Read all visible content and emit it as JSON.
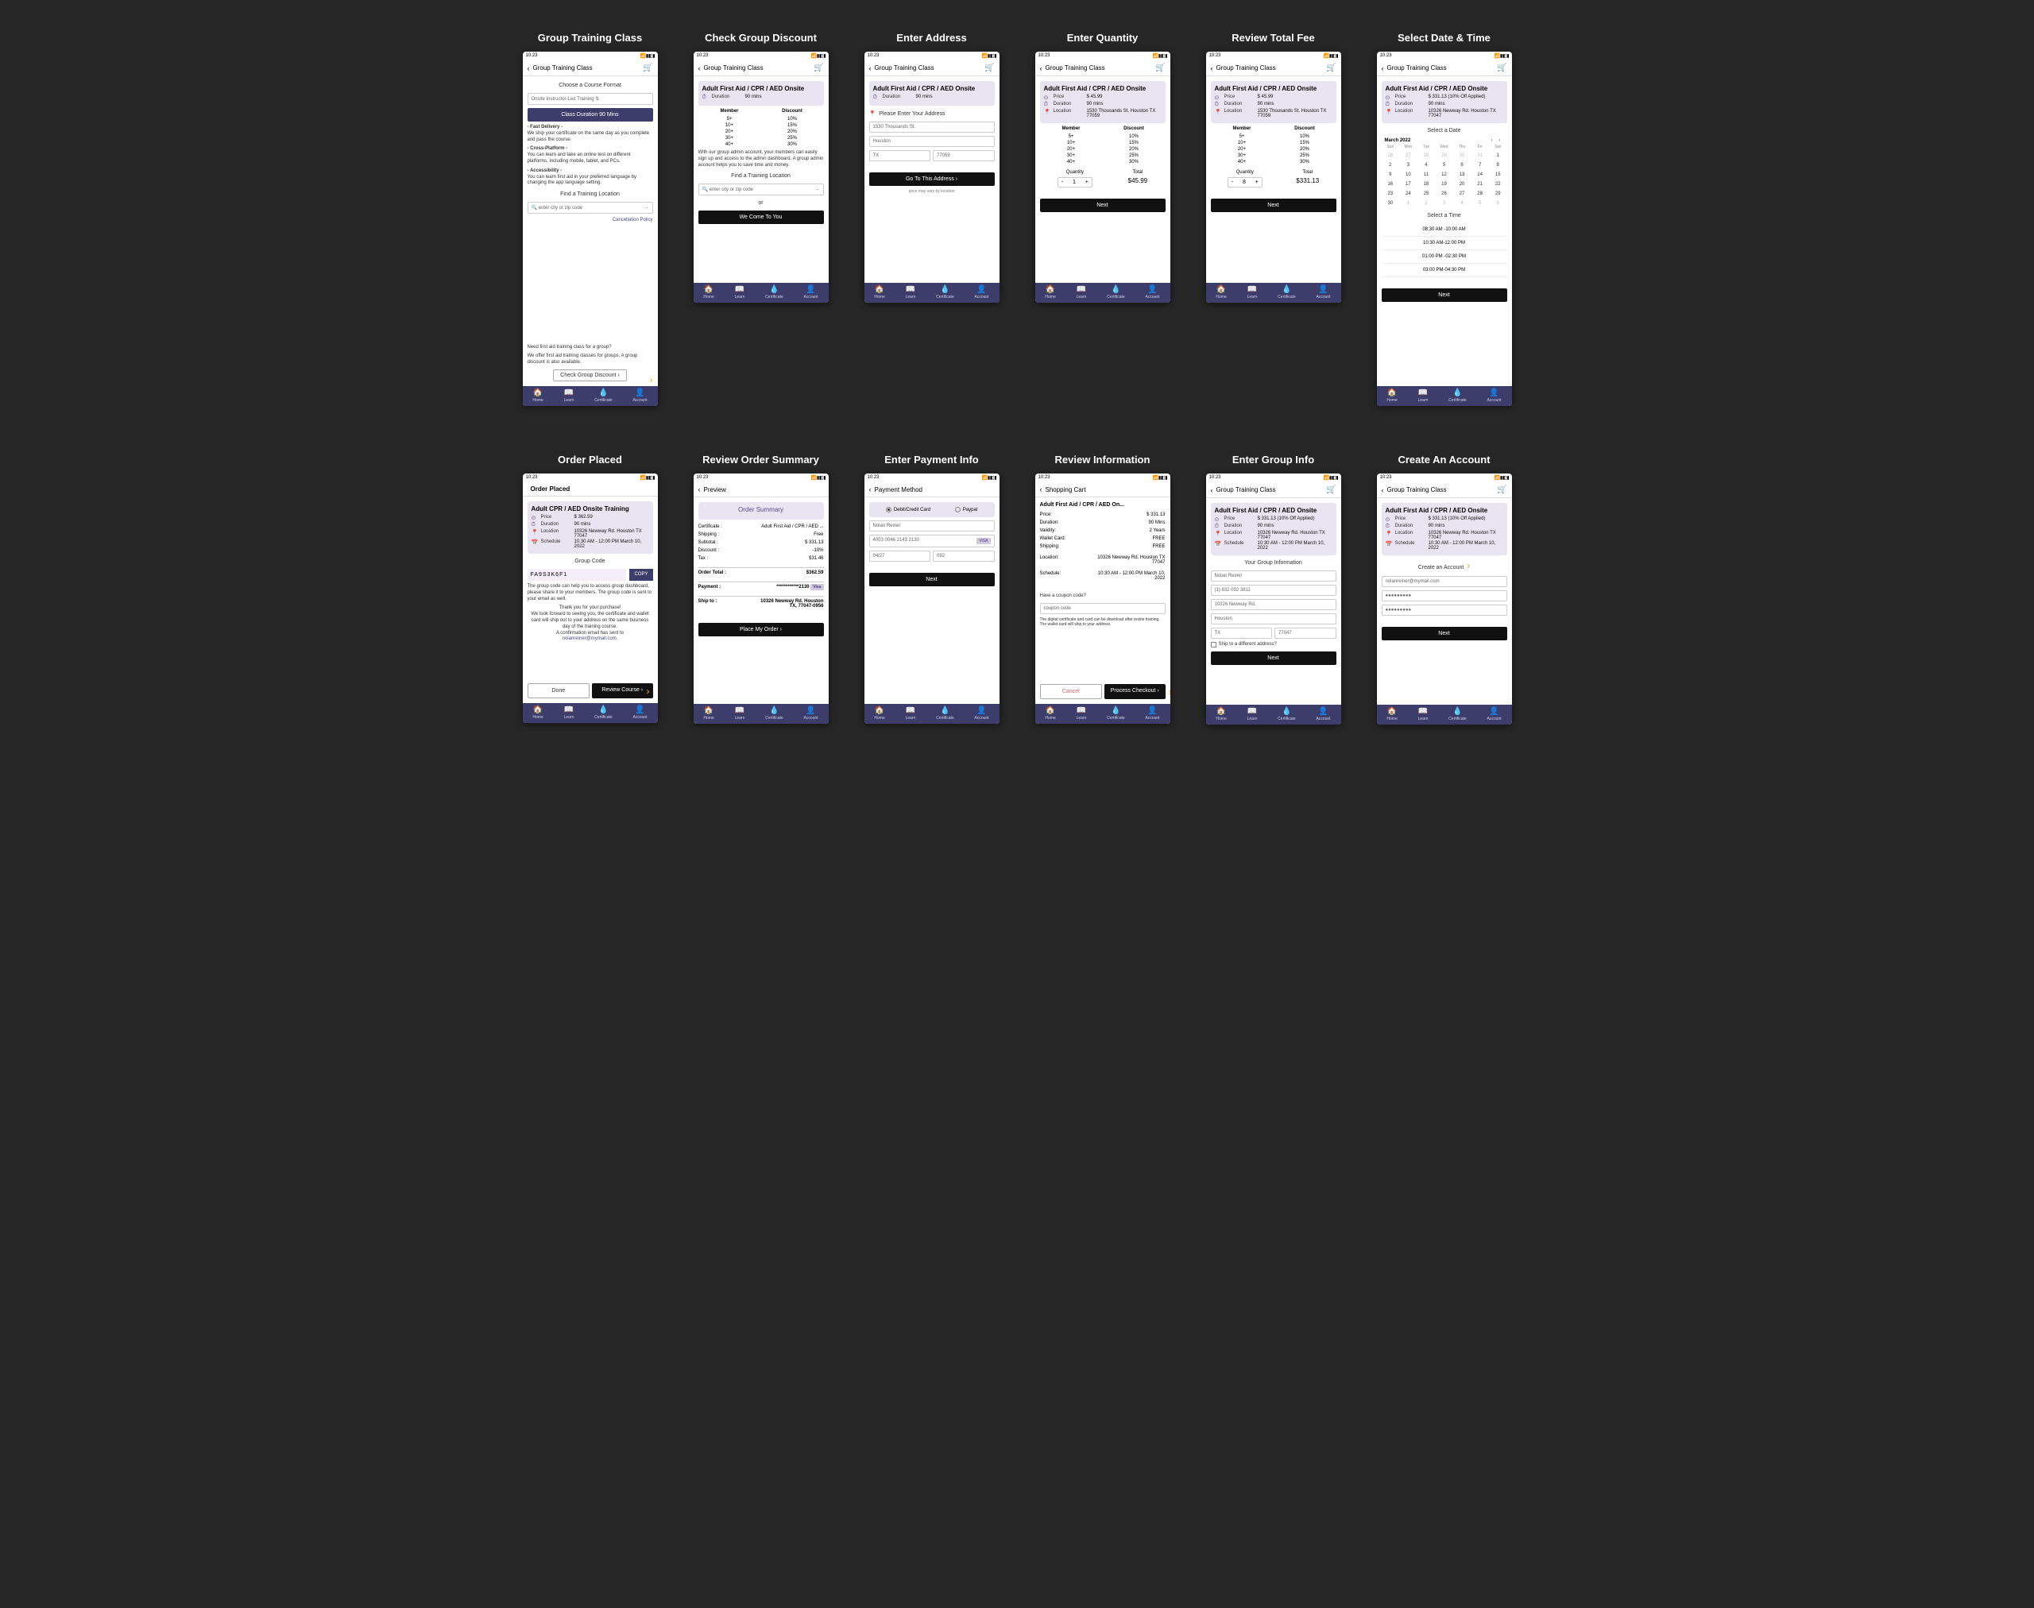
{
  "shared": {
    "time": "10:23",
    "signals": "📶 ▮ ◧ ▮",
    "cart_icon": "🛒",
    "back": "‹",
    "nav": [
      {
        "icon": "🏠",
        "label": "Home"
      },
      {
        "icon": "📖",
        "label": "Learn"
      },
      {
        "icon": "💧",
        "label": "Certificate"
      },
      {
        "icon": "👤",
        "label": "Account"
      }
    ],
    "hdr_class": "Group Training Class",
    "course_onsite": "Adult First Aid / CPR / AED Onsite",
    "next": "Next",
    "lbl_price": "Price",
    "lbl_duration": "Duration",
    "lbl_location": "Location",
    "lbl_schedule": "Schedule",
    "dur90": "90 mins",
    "addr1": "10326 Newway Rd. Houston TX 77047",
    "sched1": "10:30 AM - 12:00 PM March 10, 2022",
    "find_loc": "Find a Training Location",
    "find_ph": "🔍 enter city or zip code"
  },
  "discount_table": {
    "h1": "Member",
    "h2": "Discount",
    "rows": [
      [
        "5+",
        "10%"
      ],
      [
        "10+",
        "15%"
      ],
      [
        "20+",
        "20%"
      ],
      [
        "30+",
        "25%"
      ],
      [
        "40+",
        "30%"
      ]
    ]
  },
  "s1": {
    "cap": "Group Training Class",
    "choose": "Choose a Course Format",
    "fmt": "Onsite Instructor-Led Training ⇅",
    "dur_btn": "Class Duration  90 Mins",
    "f1t": "- Fast Delivery -",
    "f1b": "We ship your certificate on the same day as you complete and pass the course.",
    "f2t": "- Cross-Platform -",
    "f2b": "You can learn and take an online test on different platforms, including mobile, tablet, and PCs.",
    "f3t": "- Accessibility -",
    "f3b": "You can learn first aid in your preferred language by changing the app language setting.",
    "cxl": "Cancellation Policy",
    "g1": "Need first aid training class for a group?",
    "g2": "We offer first aid training classes for groups. A group discount is also available.",
    "gbtn": "Check Group Discount  ›"
  },
  "s2": {
    "cap": "Check Group Discount",
    "note": "With our group admin account, your members can easily sign up and access to the admin dashboard. A group admin account helps you to save time and money.",
    "or": "or",
    "come": "We Come To You"
  },
  "s3": {
    "cap": "Enter Address",
    "prompt": "Please Enter Your Address",
    "a1": "1530  Thousands St.",
    "a2": "Houston",
    "a3": "TX",
    "a4": "77059",
    "go": "Go To This Address  ›",
    "sub": "price may vary by location"
  },
  "s4": {
    "cap": "Enter Quantity",
    "price": "$ 45.99",
    "loc": "1530 Thousands St. Houston TX 77059",
    "qlab": "Quantity",
    "tlab": "Total",
    "q": "1",
    "t": "$45.99",
    "minus": "-",
    "plus": "+"
  },
  "s5": {
    "cap": "Review Total Fee",
    "price": "$ 45.99",
    "loc": "1530 Thousands St. Houston TX 77059",
    "q": "8",
    "t": "$331.13"
  },
  "s6": {
    "cap": "Select Date & Time",
    "price": "$ 331.13 (10% Off Applied)",
    "sel_date": "Select a Date",
    "month": "March 2022",
    "dow": [
      "Sun",
      "Mon",
      "Tue",
      "Wed",
      "Thu",
      "Fri",
      "Sat"
    ],
    "weeks": [
      [
        {
          "d": "26",
          "m": 1
        },
        {
          "d": "27",
          "m": 1
        },
        {
          "d": "28",
          "m": 1
        },
        {
          "d": "29",
          "m": 1
        },
        {
          "d": "30",
          "m": 1
        },
        {
          "d": "31",
          "m": 1
        },
        {
          "d": "1"
        }
      ],
      [
        {
          "d": "2"
        },
        {
          "d": "3"
        },
        {
          "d": "4"
        },
        {
          "d": "5"
        },
        {
          "d": "6"
        },
        {
          "d": "7"
        },
        {
          "d": "8"
        }
      ],
      [
        {
          "d": "9"
        },
        {
          "d": "10"
        },
        {
          "d": "11"
        },
        {
          "d": "12"
        },
        {
          "d": "13"
        },
        {
          "d": "14"
        },
        {
          "d": "15"
        }
      ],
      [
        {
          "d": "16"
        },
        {
          "d": "17"
        },
        {
          "d": "18"
        },
        {
          "d": "19"
        },
        {
          "d": "20"
        },
        {
          "d": "21"
        },
        {
          "d": "22"
        }
      ],
      [
        {
          "d": "23"
        },
        {
          "d": "24"
        },
        {
          "d": "25"
        },
        {
          "d": "26"
        },
        {
          "d": "27"
        },
        {
          "d": "28"
        },
        {
          "d": "29"
        }
      ],
      [
        {
          "d": "30"
        },
        {
          "d": "1",
          "m": 1
        },
        {
          "d": "2",
          "m": 1
        },
        {
          "d": "3",
          "m": 1
        },
        {
          "d": "4",
          "m": 1
        },
        {
          "d": "5",
          "m": 1
        },
        {
          "d": "6",
          "m": 1
        }
      ]
    ],
    "sel_time": "Select a Time",
    "slots": [
      "08:30 AM -10:00 AM",
      "10:30 AM-12:00 PM",
      "01:00 PM -02:30 PM",
      "03:00 PM-04:30 PM"
    ]
  },
  "s7": {
    "cap": "Create An Account",
    "price": "$ 331.13 (10% Off Applied)",
    "acct": "Create an Account",
    "email": "nolanreiner@mymail.com",
    "pw": "●●●●●●●●●"
  },
  "s8": {
    "cap": "Enter Group Info",
    "price": "$ 331.13 (10% Off Applied)",
    "git": "Your Group Information",
    "name": "Nolan Reiner",
    "ph": "(1) 832  092  3811",
    "st": "10326 Newway Rd.",
    "city": "Houston",
    "state": "TX",
    "zip": "77047",
    "diff": "Ship to a different address?"
  },
  "s9": {
    "cap": "Review Information",
    "hdr": "Shopping Cart",
    "title": "Adult First Aid / CPR / AED On...",
    "rows": [
      [
        "Price:",
        "$ 331.13"
      ],
      [
        "Duration:",
        "90 Mins"
      ],
      [
        "Validity:",
        "2 Years"
      ],
      [
        "Wallet Card:",
        "FREE"
      ],
      [
        "Shipping:",
        "FREE"
      ]
    ],
    "loc_l": "Location:",
    "loc_v": "10326 Newway Rd. Houston TX 77047",
    "sch_l": "Schedule:",
    "sch_v": "10:30 AM - 12:00 PM March 10, 2022",
    "cpn_q": "Have a coupon code?",
    "cpn_ph": "coupon code",
    "note": "The digital certificate and card can be download after onsite training. The wallet card will ship to your address.",
    "cancel": "Cancel",
    "proc": "Process Checkout  ›"
  },
  "s10": {
    "cap": "Enter Payment Info",
    "hdr": "Payment Method",
    "opt1": "Debit/Credit Card",
    "opt2": "Paypal",
    "name": "Nolan Reiner",
    "cc": "4003  0046  2143  2130",
    "visa": "VISA",
    "exp": "04/27",
    "cvv": "092"
  },
  "s11": {
    "cap": "Review Order Summary",
    "hdr": "Preview",
    "ost": "Order Summary",
    "rows": [
      [
        "Certificate :",
        "Adult First Aid / CPR / AED ..."
      ],
      [
        "Shipping :",
        "Free"
      ],
      [
        "Subtotal :",
        "$ 331.13"
      ],
      [
        "Discount :",
        "-10%"
      ],
      [
        "Tax :",
        "$31.46"
      ]
    ],
    "ot_l": "Order Total :",
    "ot_v": "$362.59",
    "pay_l": "Payment :",
    "pay_v": "************2130",
    "visa": "Visa",
    "ship_l": "Ship to :",
    "ship_v": "10326 Newway Rd. Houston TX, 77047-0956",
    "place": "Place My Order  ›"
  },
  "s12": {
    "cap": "Order Placed",
    "hdr": "Order Placed",
    "title": "Adult CPR / AED Onsite Training",
    "price": "$ 362.59",
    "gc": "Group Code",
    "code": "FA9S3K6F1",
    "copy": "COPY",
    "help": "The group code can help you to access group dashboard, please share it to your members. The group code is sent to your email as well.",
    "ty1": "Thank you for your purchase!",
    "ty2": "We look forward to seeing you, the certificate and wallet card will ship out to your address on the same business day of the training course.",
    "ty3": "A confirmation email has sent to",
    "email": "nolanreiner@mymail.com.",
    "done": "Done",
    "review": "Review Course  ›"
  }
}
